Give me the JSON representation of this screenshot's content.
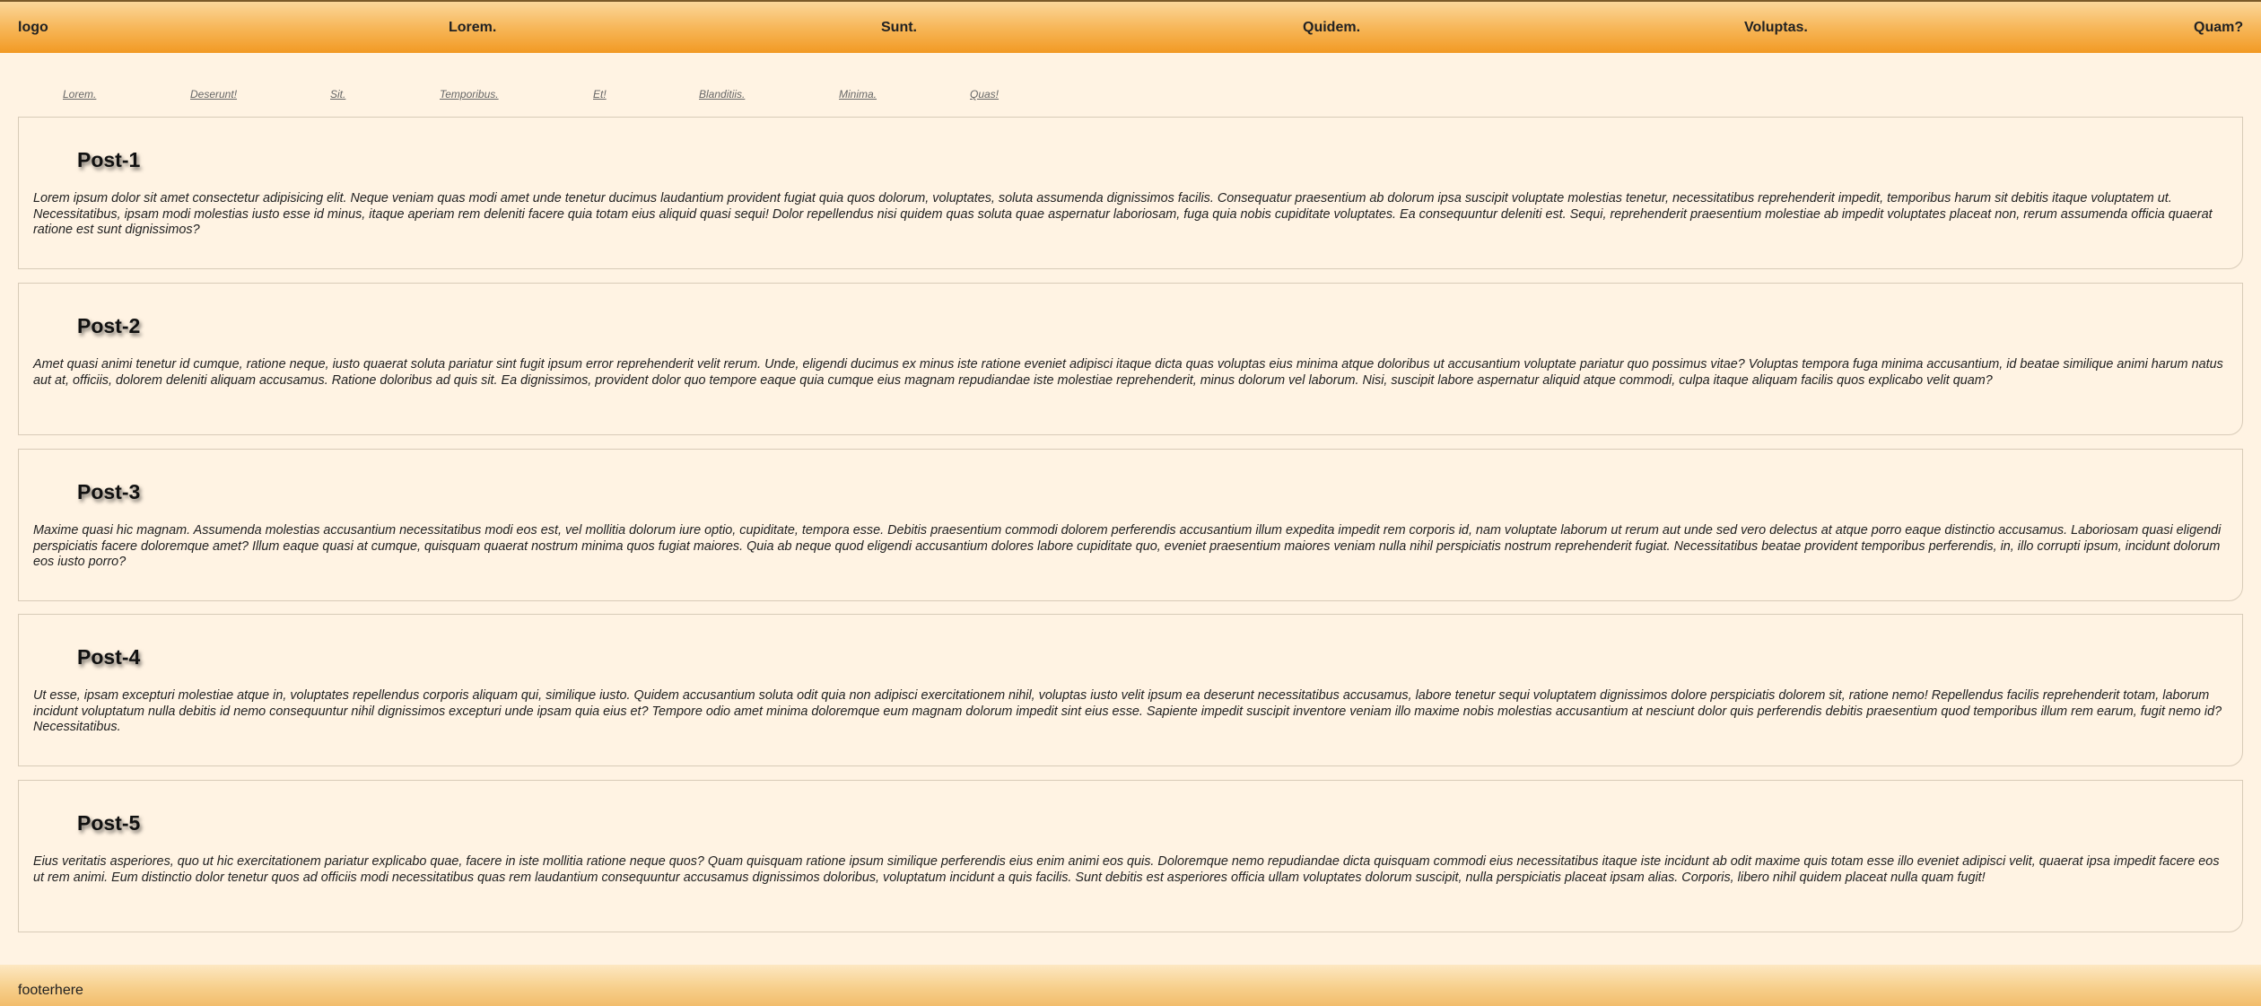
{
  "header": {
    "logo_alt": "logo",
    "nav": [
      "Lorem.",
      "Sunt.",
      "Quidem.",
      "Voluptas.",
      "Quam?"
    ]
  },
  "subnav": [
    "Lorem.",
    "Deserunt!",
    "Sit.",
    "Temporibus.",
    "Et!",
    "Blanditiis.",
    "Minima.",
    "Quas!"
  ],
  "posts": [
    {
      "title": "Post-1",
      "body": "Lorem ipsum dolor sit amet consectetur adipisicing elit. Neque veniam quas modi amet unde tenetur ducimus laudantium provident fugiat quia quos dolorum, voluptates, soluta assumenda dignissimos facilis. Consequatur praesentium ab dolorum ipsa suscipit voluptate molestias tenetur, necessitatibus reprehenderit impedit, temporibus harum sit debitis itaque voluptatem ut. Necessitatibus, ipsam modi molestias iusto esse id minus, itaque aperiam rem deleniti facere quia totam eius aliquid quasi sequi! Dolor repellendus nisi quidem quas soluta quae aspernatur laboriosam, fuga quia nobis cupiditate voluptates. Ea consequuntur deleniti est. Sequi, reprehenderit praesentium molestiae ab impedit voluptates placeat non, rerum assumenda officia quaerat ratione est sunt dignissimos?"
    },
    {
      "title": "Post-2",
      "body": "Amet quasi animi tenetur id cumque, ratione neque, iusto quaerat soluta pariatur sint fugit ipsum error reprehenderit velit rerum. Unde, eligendi ducimus ex minus iste ratione eveniet adipisci itaque dicta quas voluptas eius minima atque doloribus ut accusantium voluptate pariatur quo possimus vitae? Voluptas tempora fuga minima accusantium, id beatae similique animi harum natus aut at, officiis, dolorem deleniti aliquam accusamus. Ratione doloribus ad quis sit. Ea dignissimos, provident dolor quo tempore eaque quia cumque eius magnam repudiandae iste molestiae reprehenderit, minus dolorum vel laborum. Nisi, suscipit labore aspernatur aliquid atque commodi, culpa itaque aliquam facilis quos explicabo velit quam?"
    },
    {
      "title": "Post-3",
      "body": "Maxime quasi hic magnam. Assumenda molestias accusantium necessitatibus modi eos est, vel mollitia dolorum iure optio, cupiditate, tempora esse. Debitis praesentium commodi dolorem perferendis accusantium illum expedita impedit rem corporis id, nam voluptate laborum ut rerum aut unde sed vero delectus at atque porro eaque distinctio accusamus. Laboriosam quasi eligendi perspiciatis facere doloremque amet? Illum eaque quasi at cumque, quisquam quaerat nostrum minima quos fugiat maiores. Quia ab neque quod eligendi accusantium dolores labore cupiditate quo, eveniet praesentium maiores veniam nulla nihil perspiciatis nostrum reprehenderit fugiat. Necessitatibus beatae provident temporibus perferendis, in, illo corrupti ipsum, incidunt dolorum eos iusto porro?"
    },
    {
      "title": "Post-4",
      "body": "Ut esse, ipsam excepturi molestiae atque in, voluptates repellendus corporis aliquam qui, similique iusto. Quidem accusantium soluta odit quia non adipisci exercitationem nihil, voluptas iusto velit ipsum ea deserunt necessitatibus accusamus, labore tenetur sequi voluptatem dignissimos dolore perspiciatis dolorem sit, ratione nemo! Repellendus facilis reprehenderit totam, laborum incidunt voluptatum nulla debitis id nemo consequuntur nihil dignissimos excepturi unde ipsam quia eius et? Tempore odio amet minima doloremque eum magnam dolorum impedit sint eius esse. Sapiente impedit suscipit inventore veniam illo maxime nobis molestias accusantium at nesciunt dolor quis perferendis debitis praesentium quod temporibus illum rem earum, fugit nemo id? Necessitatibus."
    },
    {
      "title": "Post-5",
      "body": "Eius veritatis asperiores, quo ut hic exercitationem pariatur explicabo quae, facere in iste mollitia ratione neque quos? Quam quisquam ratione ipsum similique perferendis eius enim animi eos quis. Doloremque nemo repudiandae dicta quisquam commodi eius necessitatibus itaque iste incidunt ab odit maxime quis totam esse illo eveniet adipisci velit, quaerat ipsa impedit facere eos ut rem animi. Eum distinctio dolor tenetur quos ad officiis modi necessitatibus quas rem laudantium consequuntur accusamus dignissimos doloribus, voluptatum incidunt a quis facilis. Sunt debitis est asperiores officia ullam voluptates dolorum suscipit, nulla perspiciatis placeat ipsam alias. Corporis, libero nihil quidem placeat nulla quam fugit!"
    }
  ],
  "footer": {
    "text": "footerhere"
  },
  "colors": {
    "page_background": "#fff3e3",
    "header_gradient_top": "#fbd79a",
    "header_gradient_bottom": "#f29a24",
    "footer_gradient_top": "#fde8c2",
    "footer_gradient_bottom": "#f2bd6c"
  }
}
